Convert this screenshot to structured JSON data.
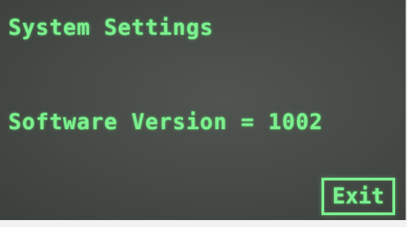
{
  "screen": {
    "title": "System Settings",
    "version_label": "Software Version",
    "version_separator": "=",
    "version_value": "1002",
    "exit_label": "Exit"
  },
  "colors": {
    "text": "#7cf08e",
    "background": "#464a46"
  }
}
